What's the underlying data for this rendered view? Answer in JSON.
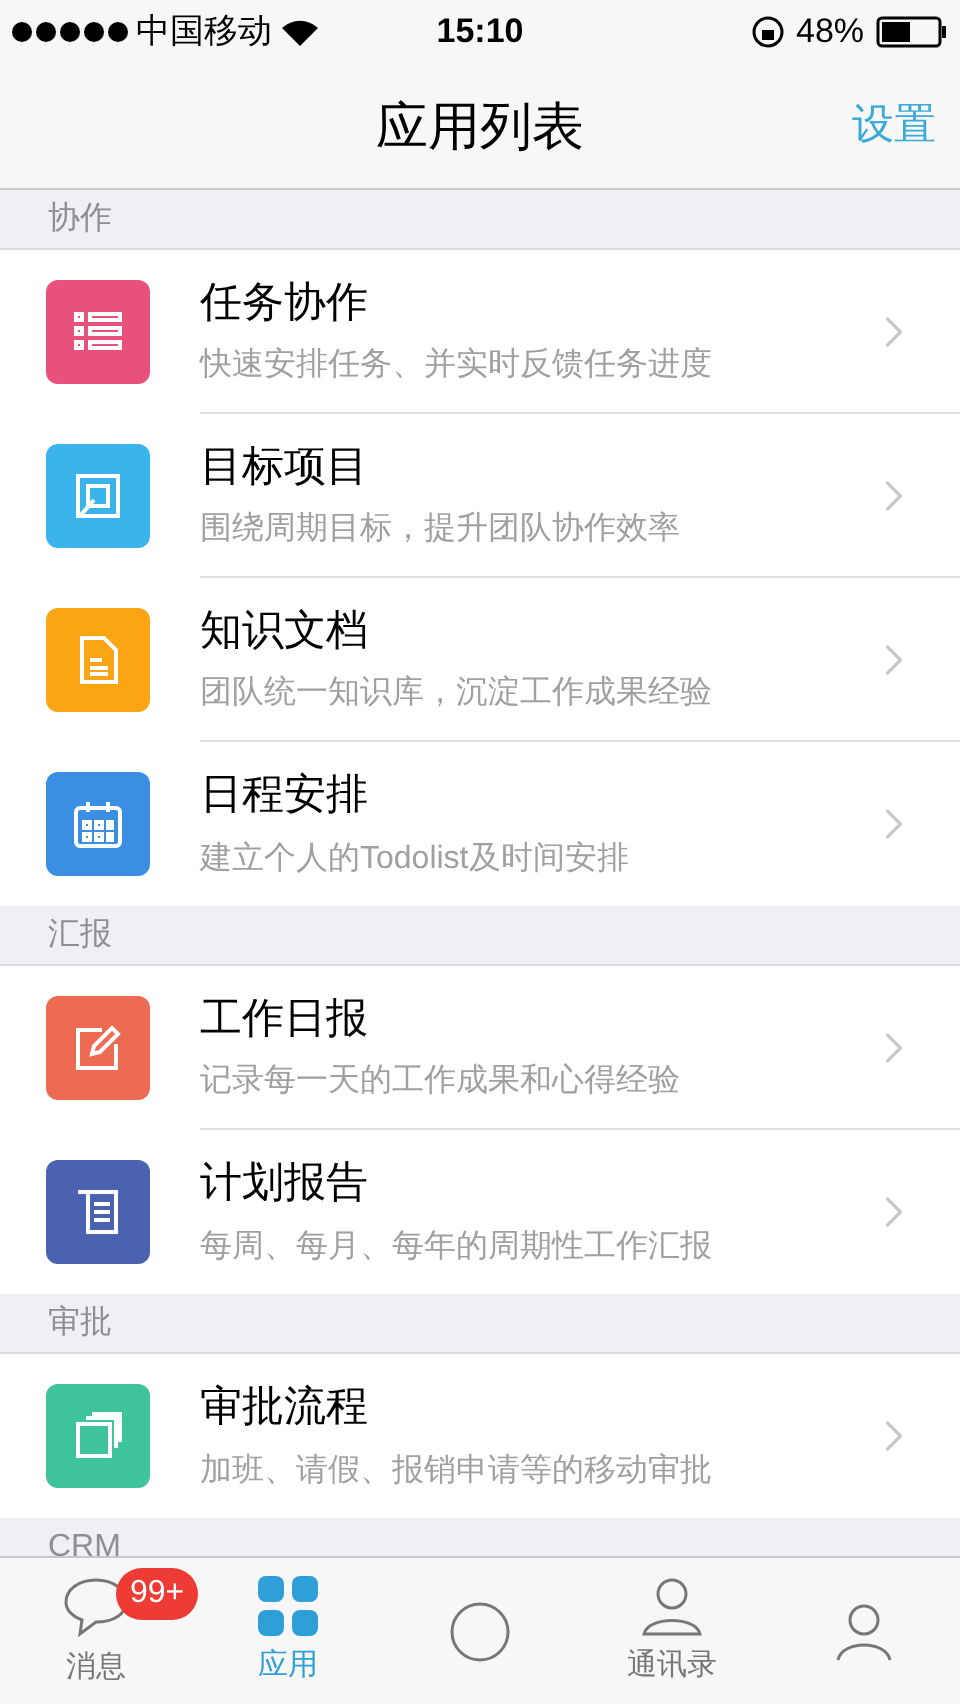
{
  "status_bar": {
    "carrier": "中国移动",
    "time": "15:10",
    "battery": "48%"
  },
  "nav": {
    "title": "应用列表",
    "action": "设置"
  },
  "sections": [
    {
      "title": "协作",
      "items": [
        {
          "kind": "list",
          "title": "任务协作",
          "subtitle": "快速安排任务、并实时反馈任务进度",
          "color": "#e8527a"
        },
        {
          "kind": "target",
          "title": "目标项目",
          "subtitle": "围绕周期目标，提升团队协作效率",
          "color": "#3bb4ec"
        },
        {
          "kind": "doc",
          "title": "知识文档",
          "subtitle": "团队统一知识库，沉淀工作成果经验",
          "color": "#fba414"
        },
        {
          "kind": "calendar",
          "title": "日程安排",
          "subtitle": "建立个人的Todolist及时间安排",
          "color": "#3a8fe3"
        }
      ]
    },
    {
      "title": "汇报",
      "items": [
        {
          "kind": "edit",
          "title": "工作日报",
          "subtitle": "记录每一天的工作成果和心得经验",
          "color": "#ed6a53"
        },
        {
          "kind": "report",
          "title": "计划报告",
          "subtitle": "每周、每月、每年的周期性工作汇报",
          "color": "#4a62b0"
        }
      ]
    },
    {
      "title": "审批",
      "items": [
        {
          "kind": "stack",
          "title": "审批流程",
          "subtitle": "加班、请假、报销申请等的移动审批",
          "color": "#3ec39a"
        }
      ]
    },
    {
      "title": "CRM"
    }
  ],
  "tab_bar": [
    {
      "kind": "chat",
      "label": "消息",
      "badge": "99+",
      "selected": false
    },
    {
      "kind": "apps",
      "label": "应用",
      "selected": true
    },
    {
      "kind": "circle",
      "selected": false
    },
    {
      "kind": "contacts",
      "label": "通讯录",
      "selected": false
    },
    {
      "kind": "person",
      "selected": false
    }
  ]
}
